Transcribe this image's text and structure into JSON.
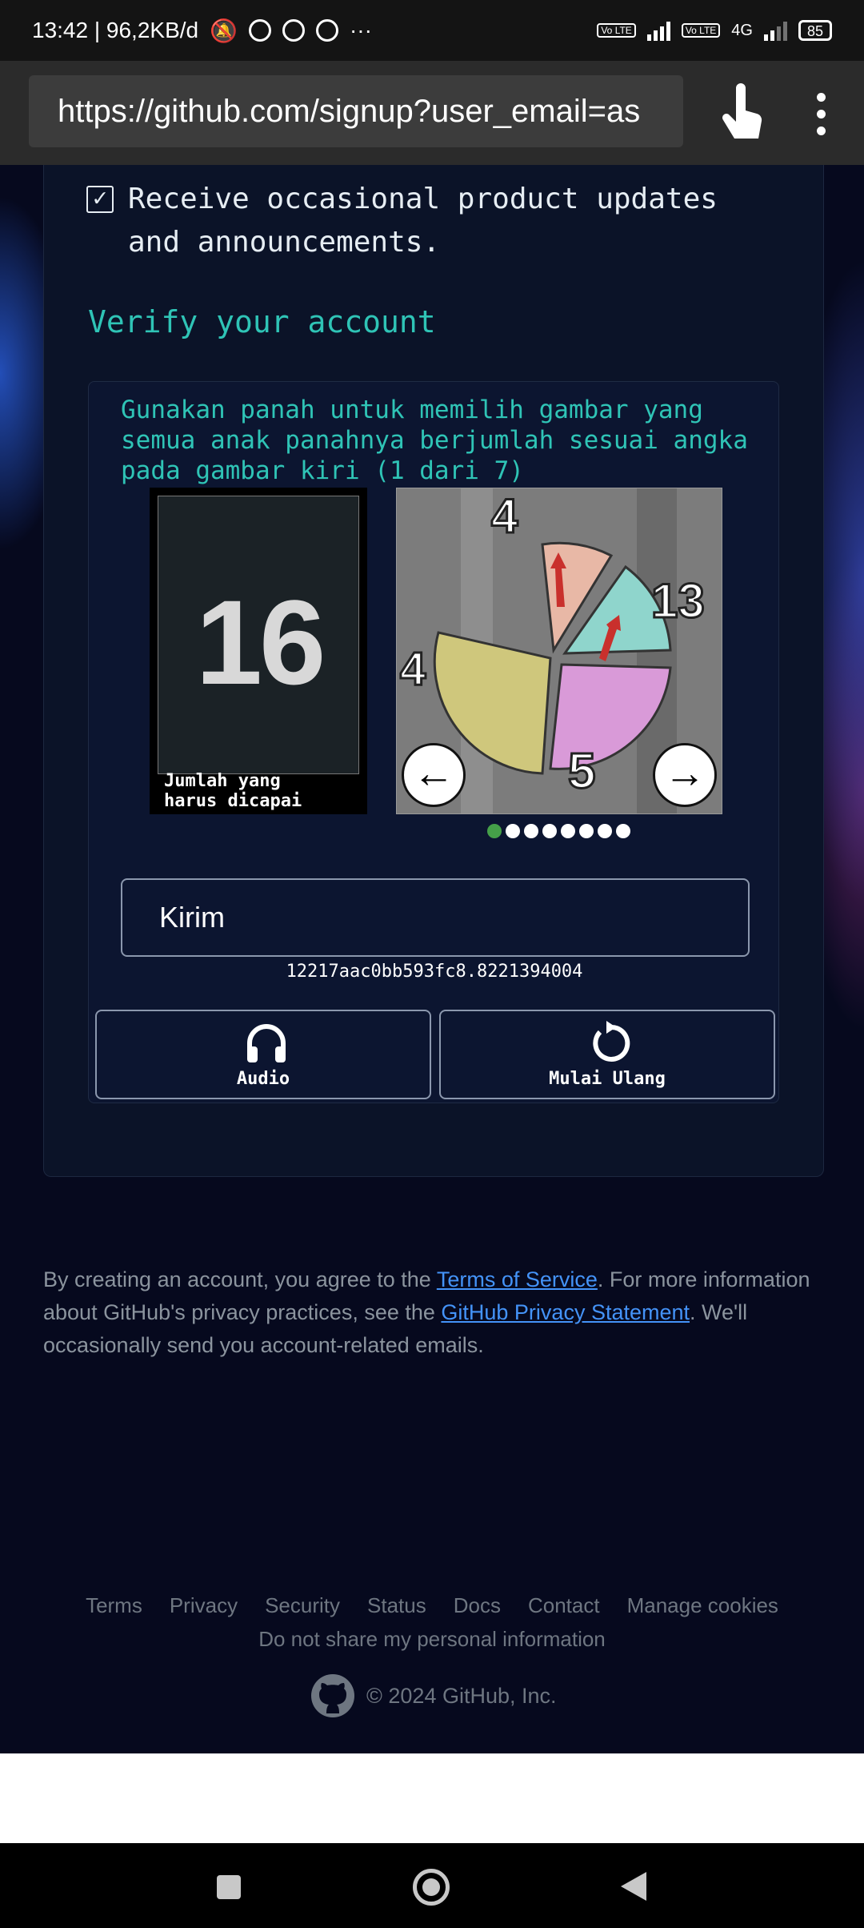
{
  "status_bar": {
    "time_speed": "13:42 | 96,2KB/d",
    "more": "···",
    "net_4g": "4G",
    "volte": "Vo LTE",
    "battery": "85"
  },
  "browser": {
    "url": "https://github.com/signup?user_email=as"
  },
  "form": {
    "updates_checkbox_mark": "✓",
    "updates_checkbox_label": "Receive occasional product updates and announcements.",
    "verify_title": "Verify your account"
  },
  "captcha": {
    "instruction": "Gunakan panah untuk memilih gambar yang semua anak panahnya berjumlah sesuai angka pada gambar kiri (1 dari 7)",
    "target_number": "16",
    "target_caption_line1": "Jumlah yang",
    "target_caption_line2": "harus dicapai",
    "wheel_numbers": [
      "4",
      "13",
      "5",
      "4"
    ],
    "prev_arrow": "←",
    "next_arrow": "→",
    "pages_total": 8,
    "current_page": 1,
    "submit_label": "Kirim",
    "token": "12217aac0bb593fc8.8221394004",
    "audio_label": "Audio",
    "restart_label": "Mulai Ulang"
  },
  "legal": {
    "part1": "By creating an account, you agree to the ",
    "terms_link": "Terms of Service",
    "part2": ". For more information about GitHub's privacy practices, see the ",
    "privacy_link": "GitHub Privacy Statement",
    "part3": ". We'll occasionally send you account-related emails."
  },
  "footer": {
    "links": [
      "Terms",
      "Privacy",
      "Security",
      "Status",
      "Docs",
      "Contact",
      "Manage cookies"
    ],
    "do_not_share": "Do not share my personal information",
    "copyright": "© 2024 GitHub, Inc."
  },
  "colors": {
    "accent_teal": "#2fc4b6",
    "link_blue": "#4493f8",
    "active_dot": "#45a049"
  }
}
